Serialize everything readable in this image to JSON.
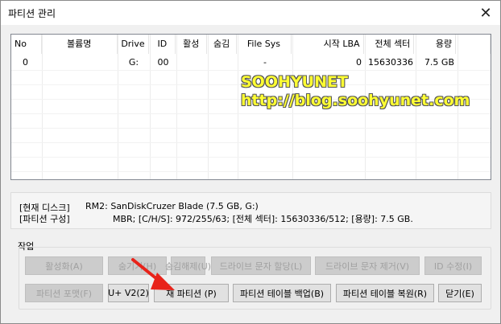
{
  "window": {
    "title": "파티션 관리"
  },
  "table": {
    "columns": [
      "No",
      "볼륨명",
      "Drive",
      "ID",
      "활성",
      "숨김",
      "File Sys",
      "시작 LBA",
      "전체 섹터",
      "용량"
    ],
    "rows": [
      {
        "no": "0",
        "volume": "",
        "drive": "G:",
        "id": "00",
        "active": "",
        "hidden": "",
        "fs": "-",
        "start_lba": "0",
        "total_sectors": "15630336",
        "capacity": "7.5 GB"
      }
    ]
  },
  "watermark": {
    "line1": "SOOHYUNET",
    "line2": "http://blog.soohyunet.com"
  },
  "info": {
    "disk_label": "[현재 디스크]",
    "disk_value": "RM2: SanDiskCruzer Blade (7.5 GB, G:)",
    "part_label": "[파티션 구성]",
    "part_value": "MBR;     [C/H/S]: 972/255/63; [전체 섹터]: 15630336/512; [용량]: 7.5 GB."
  },
  "operations": {
    "label": "작업",
    "buttons": {
      "activate": "활성화(A)",
      "hide": "숨기기(H)",
      "unhide": "숨김해제(U)",
      "assign_letter": "드라이브 문자 할당(L)",
      "remove_letter": "드라이브 문자 제거(V)",
      "edit_id": "ID 수정(I)",
      "format": "파티션 포맷(F)",
      "u_v2": "U+ V2(2)",
      "repartition": "재 파티션 (P)",
      "backup_table": "파티션 테이블 백업(B)",
      "restore_table": "파티션 테이블 복원(R)",
      "close": "닫기(E)"
    }
  },
  "colors": {
    "watermark": "#ffff33",
    "arrow": "#e8231a",
    "window_bg": "#f0f0f0"
  }
}
